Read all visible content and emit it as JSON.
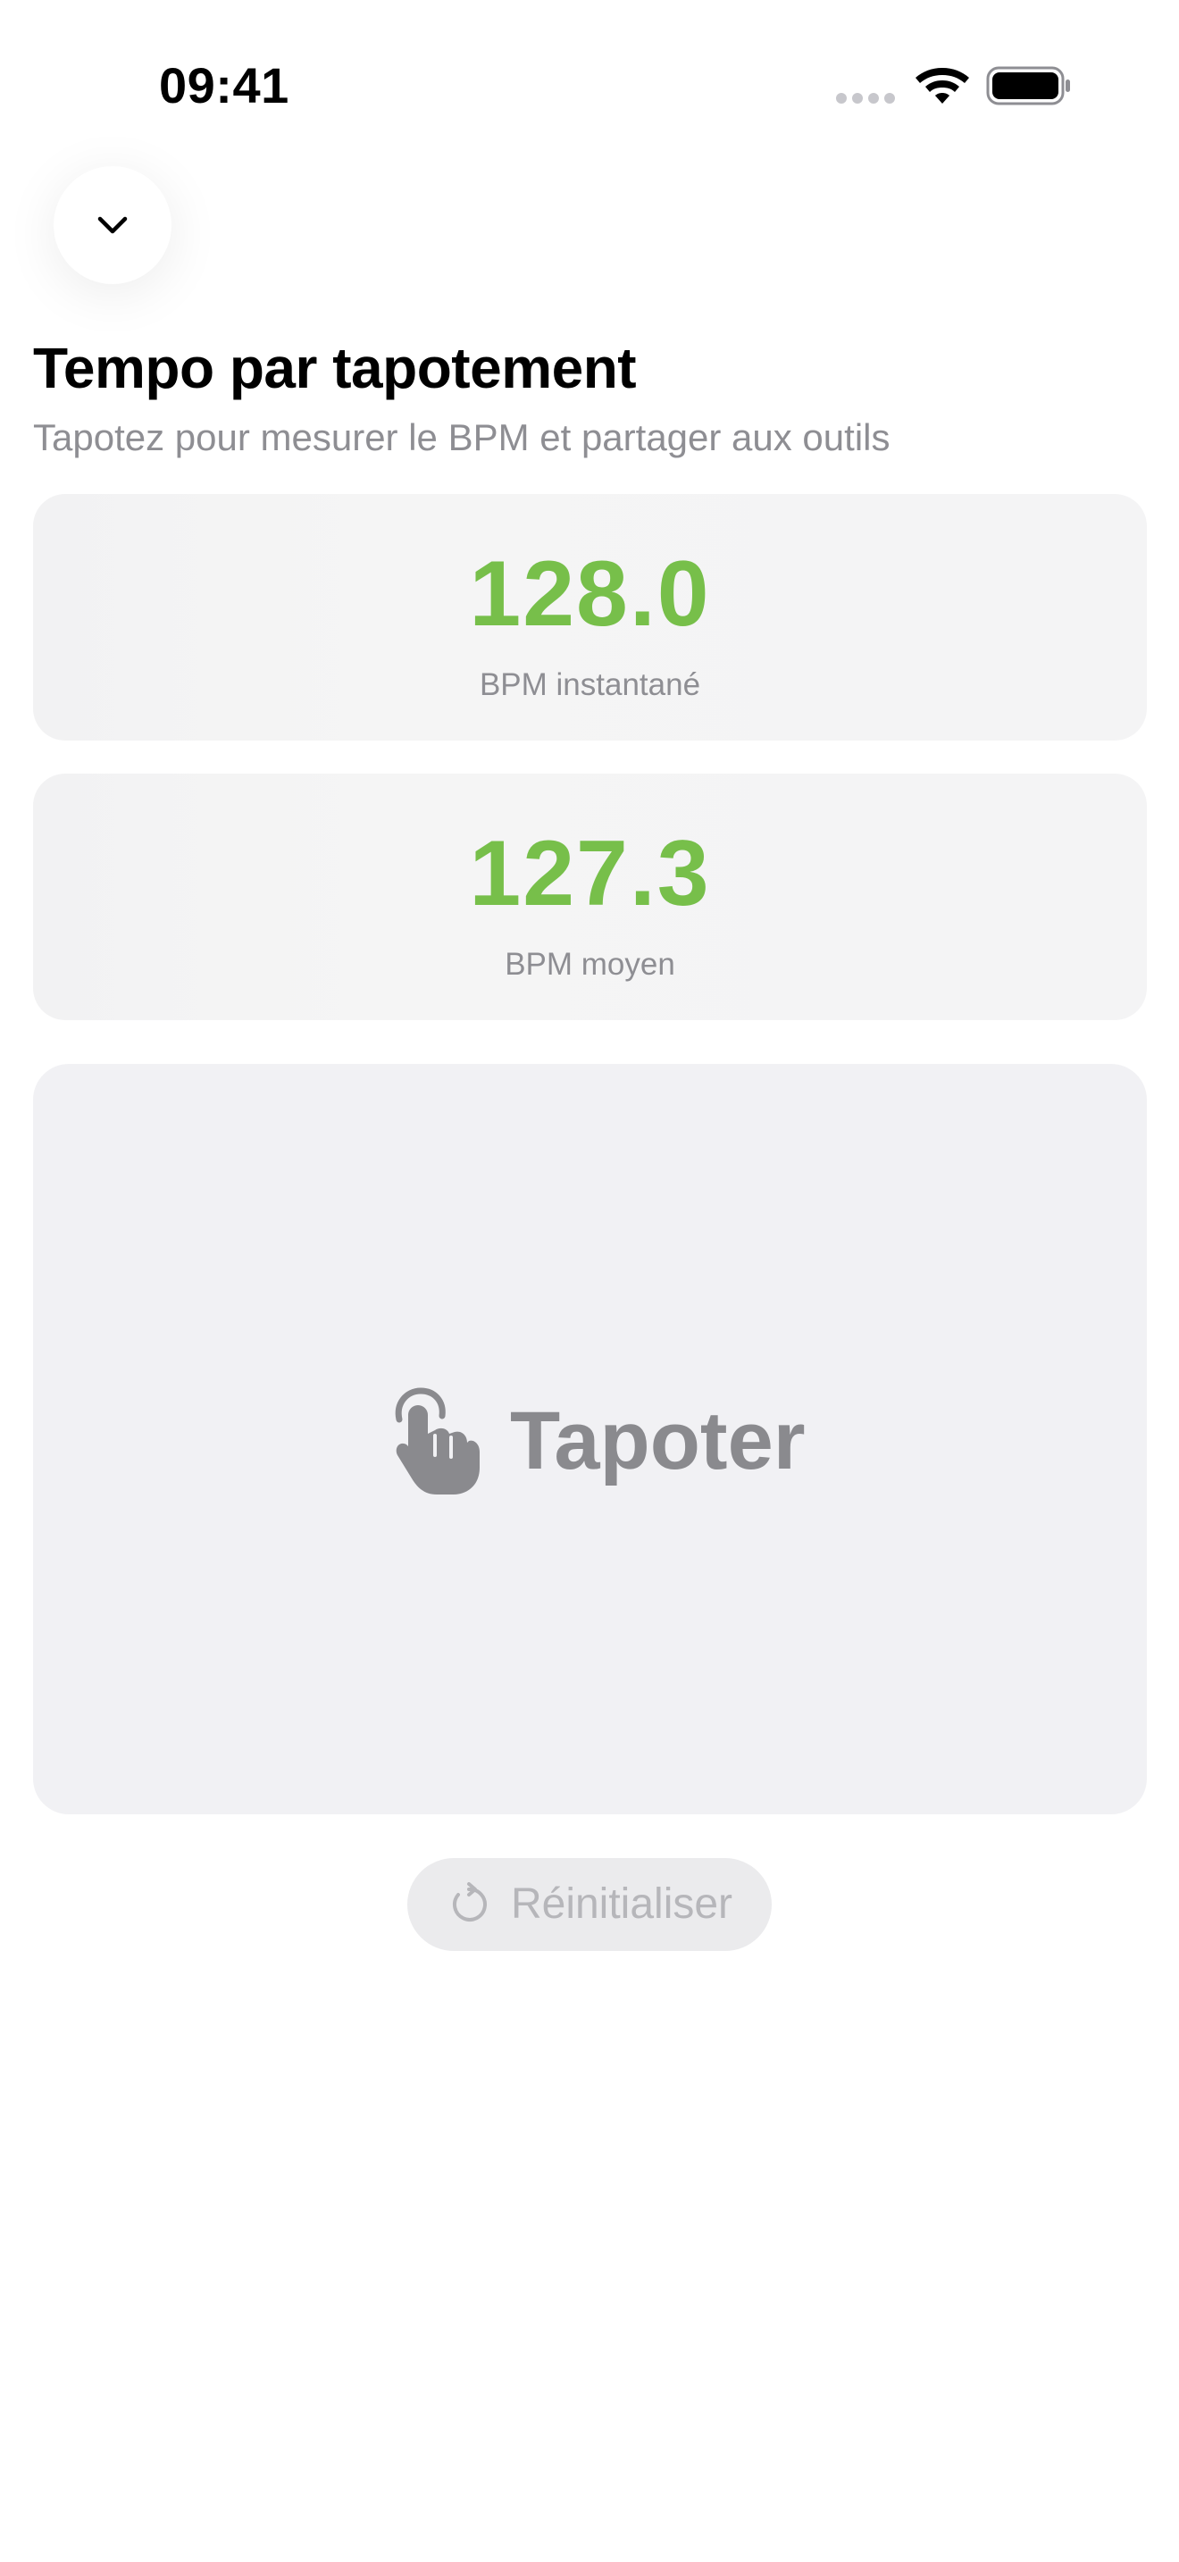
{
  "status_bar": {
    "time": "09:41",
    "signal_icon": "cellular-signal-icon",
    "wifi_icon": "wifi-icon",
    "battery_icon": "battery-icon"
  },
  "header": {
    "dismiss_icon": "chevron-down-icon",
    "title": "Tempo par tapotement",
    "subtitle": "Tapotez pour mesurer le BPM et partager aux outils"
  },
  "stats": {
    "instant": {
      "value": "128.0",
      "label": "BPM instantané"
    },
    "average": {
      "value": "127.3",
      "label": "BPM moyen"
    }
  },
  "tap_pad": {
    "icon": "hand-tap-icon",
    "label": "Tapoter"
  },
  "reset": {
    "icon": "reset-arrow-icon",
    "label": "Réinitialiser"
  },
  "colors": {
    "accent_green": "#77bf4a",
    "secondary_text": "#8e8e93",
    "card_background": "#f4f4f5",
    "tap_pad_background": "#f1f1f4"
  }
}
